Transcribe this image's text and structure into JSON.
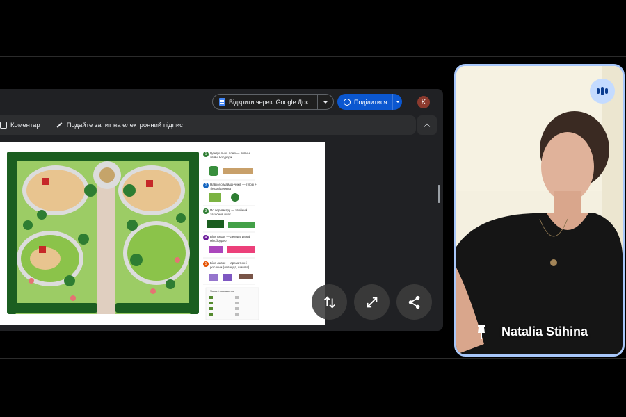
{
  "viewer": {
    "open_with_label": "Відкрити через: Google Док…",
    "share_label": "Поділитися",
    "avatar_initial": "K",
    "comment_label": "Коментар",
    "esign_label": "Подайте запит на електронний підпис"
  },
  "document": {
    "legend_items": [
      {
        "num": "1",
        "text": "Центральна алея — липи + хвійні бордюри",
        "color": "#2e7d32"
      },
      {
        "num": "2",
        "text": "Навколо майданчиків — гілові + тіньові дерева",
        "color": "#1565c0"
      },
      {
        "num": "3",
        "text": "По периметру — хвойний захисний пояс",
        "color": "#2e7d32"
      },
      {
        "num": "4",
        "text": "Біля входу — декоративний міксбордер",
        "color": "#6a1b9a"
      },
      {
        "num": "5",
        "text": "Біля лавок — ароматичні рослини (лаванда, шавлія)",
        "color": "#e65100"
      }
    ],
    "legend_title": "Умовні позначення"
  },
  "controls": {
    "swap_icon": "swap-vertical-icon",
    "fullscreen_icon": "expand-icon",
    "share_icon": "share-icon"
  },
  "participant": {
    "name": "Natalia Stihina",
    "speaking_icon": "audio-level-icon",
    "pin_icon": "pin-icon",
    "border_color": "#a8c7fa"
  }
}
